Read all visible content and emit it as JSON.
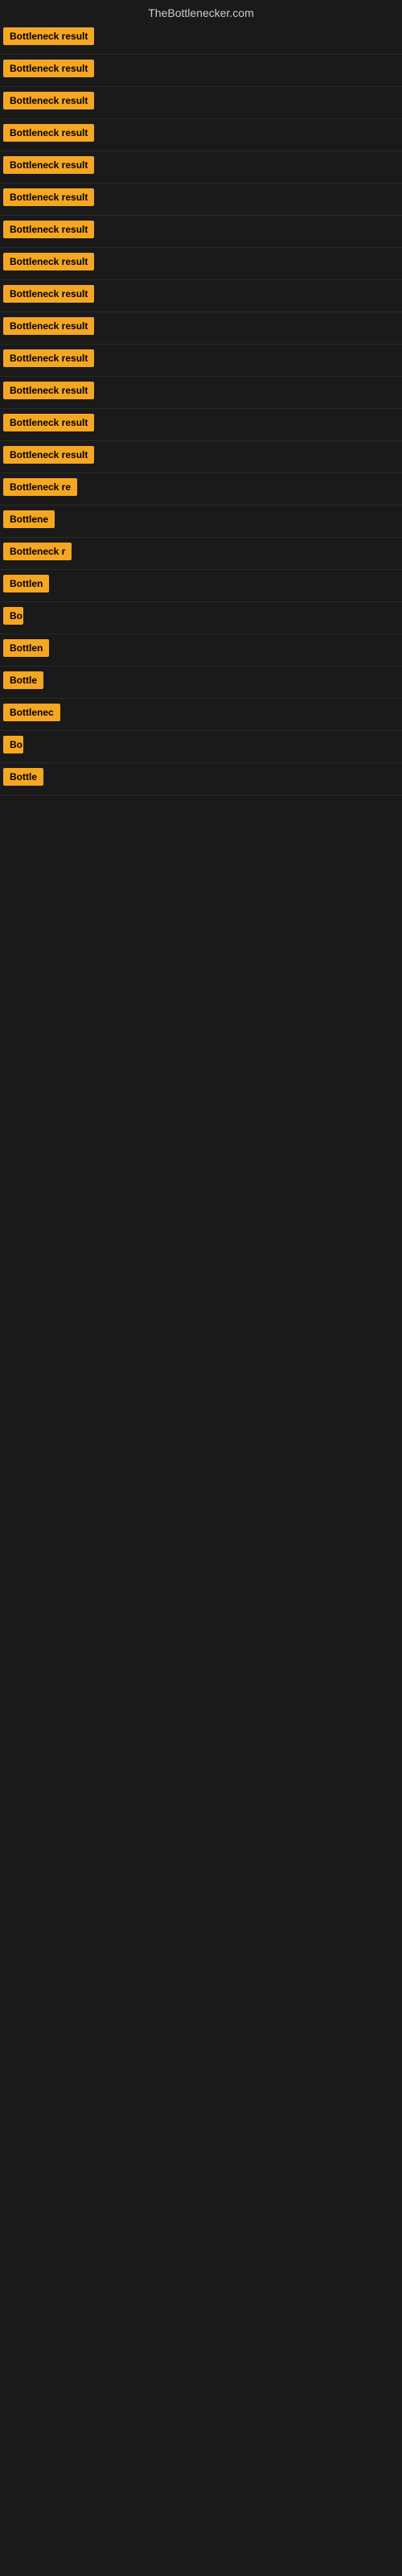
{
  "site": {
    "title": "TheBottlenecker.com"
  },
  "results": [
    {
      "id": 1,
      "label": "Bottleneck result",
      "width": 120
    },
    {
      "id": 2,
      "label": "Bottleneck result",
      "width": 120
    },
    {
      "id": 3,
      "label": "Bottleneck result",
      "width": 120
    },
    {
      "id": 4,
      "label": "Bottleneck result",
      "width": 120
    },
    {
      "id": 5,
      "label": "Bottleneck result",
      "width": 120
    },
    {
      "id": 6,
      "label": "Bottleneck result",
      "width": 120
    },
    {
      "id": 7,
      "label": "Bottleneck result",
      "width": 120
    },
    {
      "id": 8,
      "label": "Bottleneck result",
      "width": 120
    },
    {
      "id": 9,
      "label": "Bottleneck result",
      "width": 120
    },
    {
      "id": 10,
      "label": "Bottleneck result",
      "width": 120
    },
    {
      "id": 11,
      "label": "Bottleneck result",
      "width": 120
    },
    {
      "id": 12,
      "label": "Bottleneck result",
      "width": 120
    },
    {
      "id": 13,
      "label": "Bottleneck result",
      "width": 120
    },
    {
      "id": 14,
      "label": "Bottleneck result",
      "width": 120
    },
    {
      "id": 15,
      "label": "Bottleneck re",
      "width": 95
    },
    {
      "id": 16,
      "label": "Bottlene",
      "width": 70
    },
    {
      "id": 17,
      "label": "Bottleneck r",
      "width": 85
    },
    {
      "id": 18,
      "label": "Bottlen",
      "width": 63
    },
    {
      "id": 19,
      "label": "Bo",
      "width": 25
    },
    {
      "id": 20,
      "label": "Bottlen",
      "width": 63
    },
    {
      "id": 21,
      "label": "Bottle",
      "width": 50
    },
    {
      "id": 22,
      "label": "Bottlenec",
      "width": 75
    },
    {
      "id": 23,
      "label": "Bo",
      "width": 25
    },
    {
      "id": 24,
      "label": "Bottle",
      "width": 50
    }
  ]
}
